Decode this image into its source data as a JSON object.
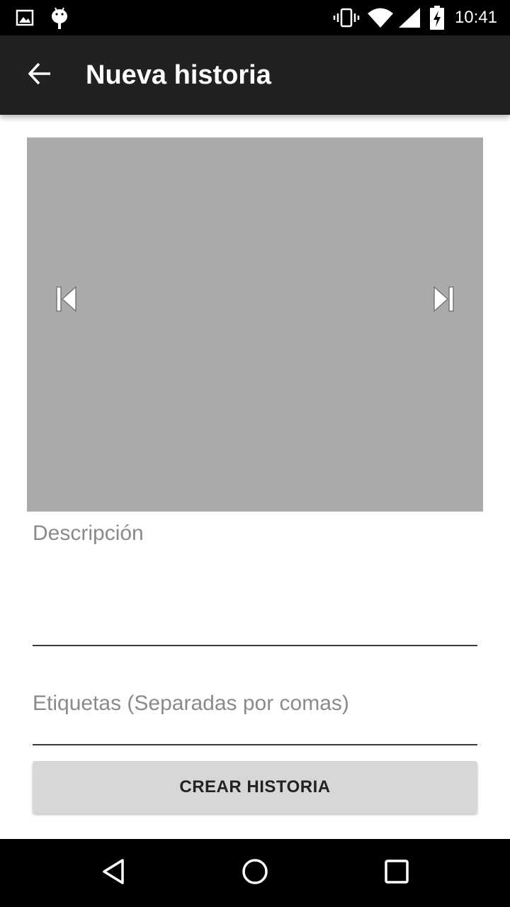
{
  "status_bar": {
    "time": "10:41",
    "left_icons": [
      "image-icon",
      "android-icon"
    ],
    "right_icons": [
      "vibrate-icon",
      "wifi-icon",
      "signal-icon",
      "battery-charging-icon"
    ]
  },
  "app_bar": {
    "title": "Nueva historia",
    "back_icon": "arrow-back-icon",
    "background": "#212121"
  },
  "gallery": {
    "background": "#aaaaaa",
    "prev_icon": "skip-previous-icon",
    "next_icon": "skip-next-icon"
  },
  "form": {
    "description": {
      "value": "",
      "placeholder": "Descripción"
    },
    "tags": {
      "value": "",
      "placeholder": "Etiquetas (Separadas por comas)"
    },
    "submit_label": "CREAR HISTORIA"
  },
  "nav_bar": {
    "icons": [
      "back-triangle-icon",
      "home-circle-icon",
      "recents-square-icon"
    ]
  }
}
